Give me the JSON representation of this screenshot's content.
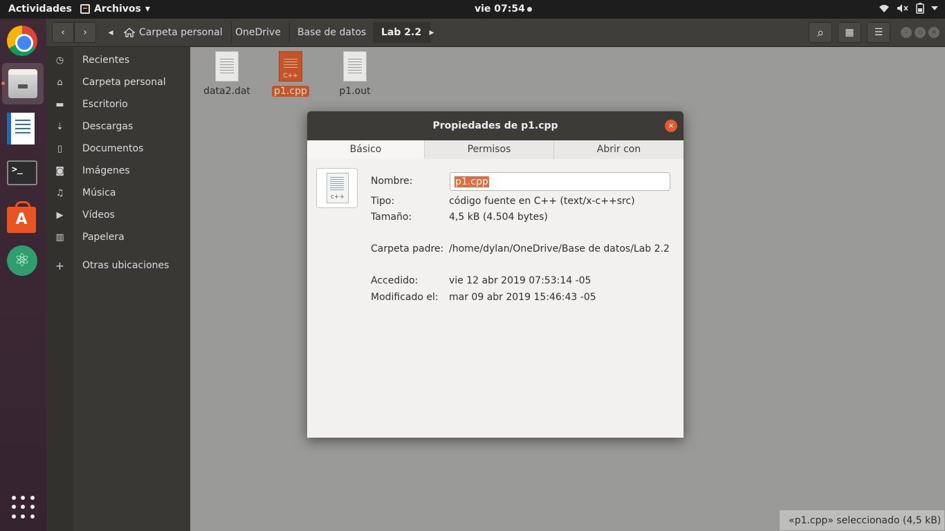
{
  "topbar": {
    "activities": "Actividades",
    "app_name": "Archivos",
    "app_arrow": "▾",
    "clock": "vie 07:54"
  },
  "dock": {
    "terminal_glyph": ">_",
    "store_glyph": "A",
    "atom_glyph": "⚛"
  },
  "header": {
    "back": "‹",
    "forward": "›",
    "crumb_left": "◂",
    "crumb_right": "▸",
    "breadcrumbs": [
      "Carpeta personal",
      "OneDrive",
      "Base de datos",
      "Lab 2.2"
    ],
    "search_icon": "⌕",
    "view_icon": "▦",
    "menu_icon": "☰"
  },
  "sidebar": {
    "items": [
      {
        "label": "Recientes",
        "icon": "◷"
      },
      {
        "label": "Carpeta personal",
        "icon": "⌂"
      },
      {
        "label": "Escritorio",
        "icon": "▬"
      },
      {
        "label": "Descargas",
        "icon": "⇣"
      },
      {
        "label": "Documentos",
        "icon": "▯"
      },
      {
        "label": "Imágenes",
        "icon": "◙"
      },
      {
        "label": "Música",
        "icon": "♫"
      },
      {
        "label": "Vídeos",
        "icon": "▶"
      },
      {
        "label": "Papelera",
        "icon": "▥"
      },
      {
        "label": "Otras ubicaciones",
        "icon": "+"
      }
    ]
  },
  "files": [
    {
      "name": "data2.dat"
    },
    {
      "name": "p1.cpp",
      "tag": "C++"
    },
    {
      "name": "p1.out"
    }
  ],
  "status": "«p1.cpp» seleccionado  (4,5 kB)",
  "dialog": {
    "title": "Propiedades de p1.cpp",
    "close": "×",
    "tabs": [
      "Básico",
      "Permisos",
      "Abrir con"
    ],
    "icon_tag": "c++",
    "name_label": "Nombre:",
    "name_value": "p1.cpp",
    "type_label": "Tipo:",
    "type_value": "código fuente en C++ (text/x-c++src)",
    "size_label": "Tamaño:",
    "size_value": "4,5 kB (4.504 bytes)",
    "parent_label": "Carpeta padre:",
    "parent_value": "/home/dylan/OneDrive/Base de datos/Lab 2.2",
    "accessed_label": "Accedido:",
    "accessed_value": "vie 12 abr 2019 07:53:14 -05",
    "modified_label": "Modificado el:",
    "modified_value": "mar 09 abr 2019 15:46:43 -05"
  }
}
